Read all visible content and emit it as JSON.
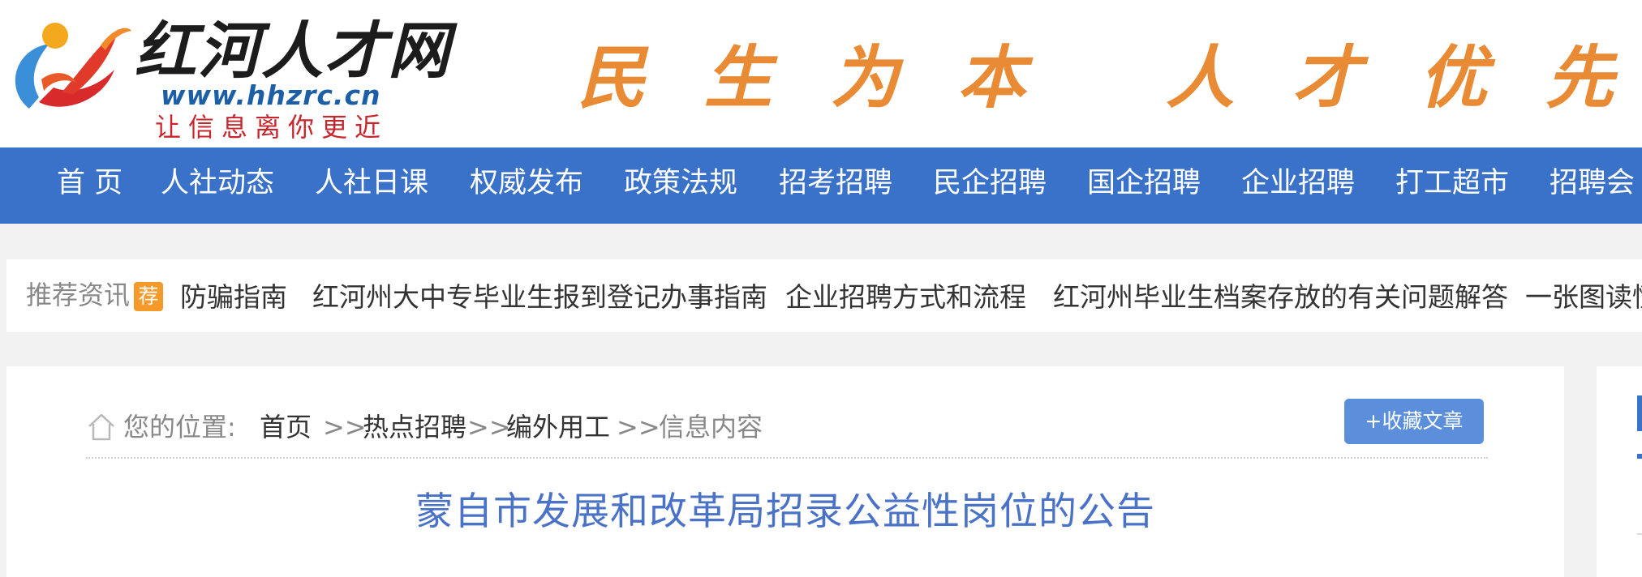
{
  "header": {
    "logo_title": "红河人才网",
    "logo_url": "www.hhzrc.cn",
    "logo_slogan": "让信息离你更近",
    "motto": "民生为本 人才优先"
  },
  "nav": {
    "items": [
      "首 页",
      "人社动态",
      "人社日课",
      "权威发布",
      "政策法规",
      "招考招聘",
      "民企招聘",
      "国企招聘",
      "企业招聘",
      "打工超市",
      "招聘会"
    ]
  },
  "recommend": {
    "label": "推荐资讯",
    "badge": "荐",
    "links": [
      "防骗指南",
      "红河州大中专毕业生报到登记办事指南",
      "企业招聘方式和流程",
      "红河州毕业生档案存放的有关问题解答",
      "一张图读懂"
    ]
  },
  "breadcrumb": {
    "prefix": "您的位置:",
    "home": "首页",
    "sep1": ">>",
    "hot": "热点招聘",
    "sep2": ">>",
    "category": "编外用工",
    "sep3": ">>",
    "current": "信息内容"
  },
  "favorite_button": "+收藏文章",
  "article": {
    "title": "蒙自市发展和改革局招录公益性岗位的公告"
  },
  "colors": {
    "nav_bg": "#3b72c9",
    "title_blue": "#4a72c6",
    "motto_orange": "#e98a35",
    "badge_orange": "#f39a2b",
    "button_blue": "#5c8fdb"
  }
}
